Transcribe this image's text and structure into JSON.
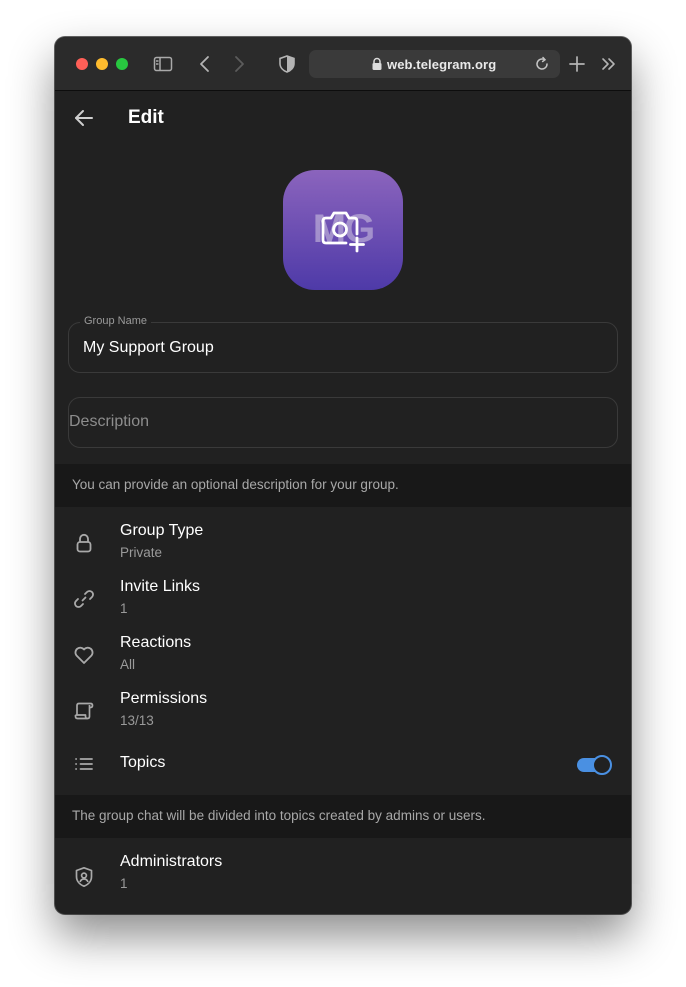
{
  "browser": {
    "url": "web.telegram.org"
  },
  "header": {
    "title": "Edit"
  },
  "avatar": {
    "initials": "MG"
  },
  "form": {
    "group_name_label": "Group Name",
    "group_name_value": "My Support Group",
    "description_placeholder": "Description",
    "description_hint": "You can provide an optional description for your group."
  },
  "settings": {
    "group_type": {
      "title": "Group Type",
      "value": "Private"
    },
    "invite_links": {
      "title": "Invite Links",
      "value": "1"
    },
    "reactions": {
      "title": "Reactions",
      "value": "All"
    },
    "permissions": {
      "title": "Permissions",
      "value": "13/13"
    },
    "topics": {
      "title": "Topics",
      "enabled": true
    },
    "topics_hint": "The group chat will be divided into topics created by admins or users.",
    "administrators": {
      "title": "Administrators",
      "value": "1"
    }
  },
  "colors": {
    "background": "#212121",
    "hint_background": "#181818",
    "accent": "#4a90e2",
    "avatar_gradient_top": "#8b64bd",
    "avatar_gradient_bottom": "#4e3aa8"
  }
}
